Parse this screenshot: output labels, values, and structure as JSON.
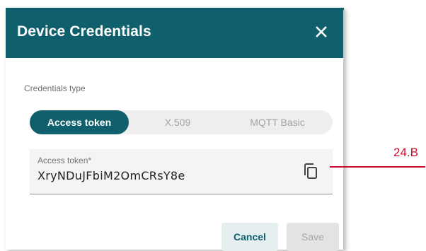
{
  "dialog": {
    "title": "Device Credentials",
    "close_icon": "close-icon"
  },
  "credentials": {
    "type_label": "Credentials type",
    "options": [
      "Access token",
      "X.509",
      "MQTT Basic"
    ],
    "selected": "Access token"
  },
  "access_token": {
    "label": "Access token*",
    "value": "XryNDuJFbiM2OmCRsY8e",
    "copy_icon": "copy-icon"
  },
  "actions": {
    "cancel_label": "Cancel",
    "save_label": "Save"
  },
  "annotation": {
    "label": "24.B"
  },
  "colors": {
    "brand": "#0f5f6c",
    "annotation": "#c8102e"
  }
}
